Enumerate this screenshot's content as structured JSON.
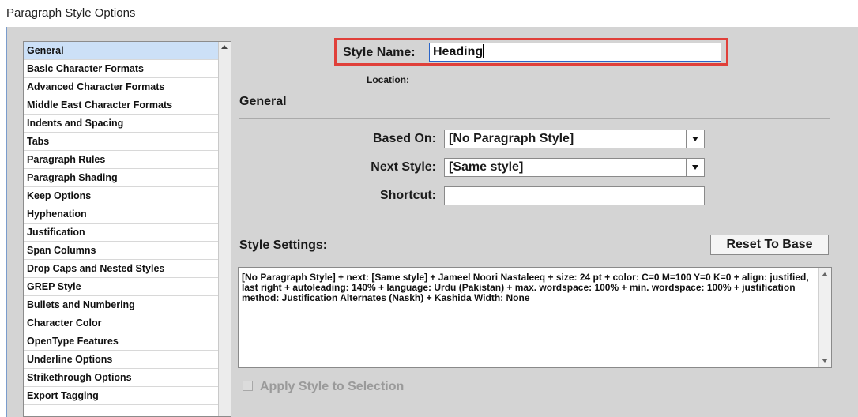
{
  "window": {
    "title": "Paragraph Style Options"
  },
  "sidebar": {
    "items": [
      {
        "label": "General",
        "selected": true
      },
      {
        "label": "Basic Character Formats"
      },
      {
        "label": "Advanced Character Formats"
      },
      {
        "label": "Middle East Character Formats"
      },
      {
        "label": "Indents and Spacing"
      },
      {
        "label": "Tabs"
      },
      {
        "label": "Paragraph Rules"
      },
      {
        "label": "Paragraph Shading"
      },
      {
        "label": "Keep Options"
      },
      {
        "label": "Hyphenation"
      },
      {
        "label": "Justification"
      },
      {
        "label": "Span Columns"
      },
      {
        "label": "Drop Caps and Nested Styles"
      },
      {
        "label": "GREP Style"
      },
      {
        "label": "Bullets and Numbering"
      },
      {
        "label": "Character Color"
      },
      {
        "label": "OpenType Features"
      },
      {
        "label": "Underline Options"
      },
      {
        "label": "Strikethrough Options"
      },
      {
        "label": "Export Tagging"
      }
    ]
  },
  "style_name": {
    "label": "Style Name:",
    "value": "Heading",
    "highlight_color": "#e0403a"
  },
  "location": {
    "label": "Location:"
  },
  "section": {
    "title": "General"
  },
  "based_on": {
    "label": "Based On:",
    "value": "[No Paragraph Style]"
  },
  "next_style": {
    "label": "Next Style:",
    "value": "[Same style]"
  },
  "shortcut": {
    "label": "Shortcut:",
    "value": ""
  },
  "settings": {
    "label": "Style Settings:",
    "reset_label": "Reset To Base",
    "text": "[No Paragraph Style] + next: [Same style] + Jameel Noori Nastaleeq + size: 24 pt + color: C=0 M=100 Y=0 K=0 + align: justified, last right + autoleading: 140% + language: Urdu (Pakistan) + max. wordspace: 100% + min. wordspace: 100% + justification method: Justification Alternates (Naskh) + Kashida Width: None"
  },
  "apply": {
    "label": "Apply Style to Selection",
    "checked": false,
    "enabled": false
  }
}
